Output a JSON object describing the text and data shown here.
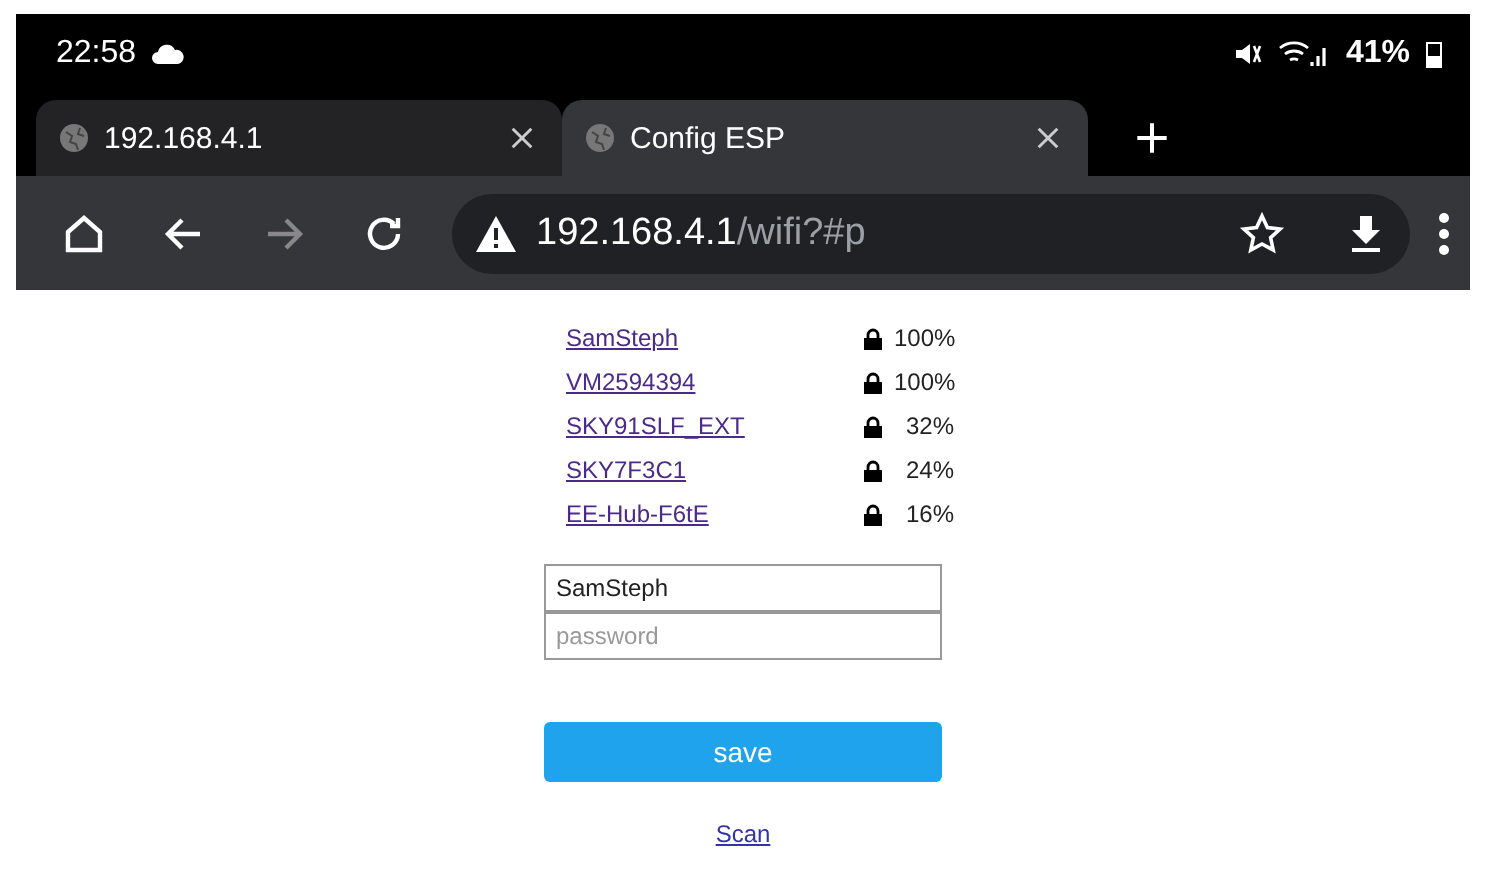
{
  "status_bar": {
    "time": "22:58",
    "battery": "41%"
  },
  "tabs": [
    {
      "label": "192.168.4.1",
      "selected": false
    },
    {
      "label": "Config ESP",
      "selected": true
    }
  ],
  "address_bar": {
    "host": "192.168.4.1",
    "path": "/wifi?#p"
  },
  "networks": [
    {
      "name": "SamSteph",
      "signal": "100%"
    },
    {
      "name": "VM2594394",
      "signal": "100%"
    },
    {
      "name": "SKY91SLF_EXT",
      "signal": "32%"
    },
    {
      "name": "SKY7F3C1",
      "signal": "24%"
    },
    {
      "name": "EE-Hub-F6tE",
      "signal": "16%"
    }
  ],
  "ssid_field": {
    "value": "SamSteph"
  },
  "password_field": {
    "placeholder": "password"
  },
  "save_button": "save",
  "scan_link": "Scan"
}
